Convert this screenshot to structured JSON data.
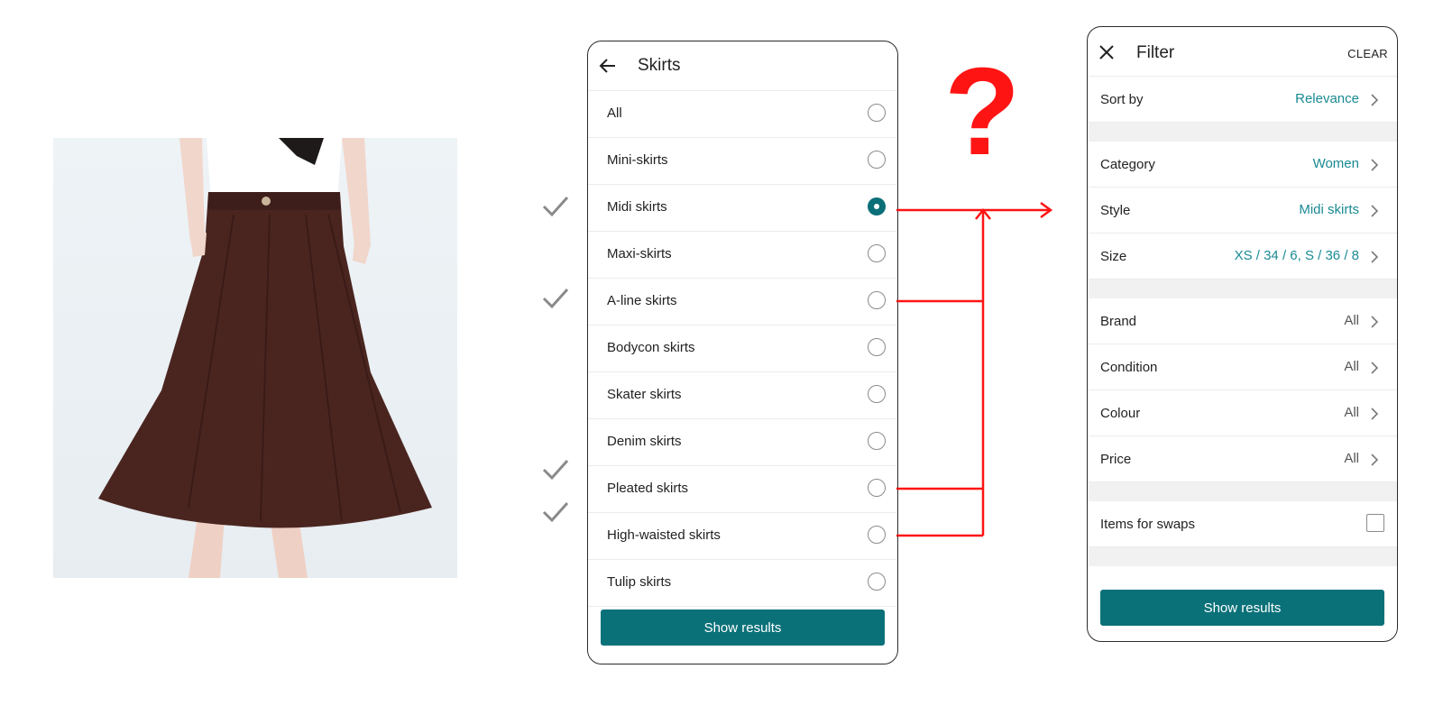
{
  "left_panel": {
    "title": "Skirts",
    "items": [
      {
        "label": "All",
        "selected": false
      },
      {
        "label": "Mini-skirts",
        "selected": false
      },
      {
        "label": "Midi skirts",
        "selected": true
      },
      {
        "label": "Maxi-skirts",
        "selected": false
      },
      {
        "label": "A-line skirts",
        "selected": false
      },
      {
        "label": "Bodycon skirts",
        "selected": false
      },
      {
        "label": "Skater skirts",
        "selected": false
      },
      {
        "label": "Denim skirts",
        "selected": false
      },
      {
        "label": "Pleated skirts",
        "selected": false
      },
      {
        "label": "High-waisted skirts",
        "selected": false
      },
      {
        "label": "Tulip skirts",
        "selected": false
      }
    ],
    "show_results_label": "Show results"
  },
  "right_panel": {
    "title": "Filter",
    "clear_label": "CLEAR",
    "sort_by": {
      "label": "Sort by",
      "value": "Relevance"
    },
    "category": {
      "label": "Category",
      "value": "Women"
    },
    "style": {
      "label": "Style",
      "value": "Midi skirts"
    },
    "size": {
      "label": "Size",
      "value": "XS / 34 / 6, S / 36 / 8"
    },
    "brand": {
      "label": "Brand",
      "value": "All"
    },
    "condition": {
      "label": "Condition",
      "value": "All"
    },
    "colour": {
      "label": "Colour",
      "value": "All"
    },
    "price": {
      "label": "Price",
      "value": "All"
    },
    "swaps": {
      "label": "Items for swaps",
      "checked": false
    },
    "show_results_label": "Show results"
  },
  "annotations": {
    "question_mark": "?",
    "checked_items": [
      "Midi skirts",
      "A-line skirts",
      "Pleated skirts",
      "High-waisted skirts"
    ]
  },
  "colors": {
    "accent": "#0b7179",
    "accent_text": "#1a8a93",
    "annotation_red": "#ff1414",
    "skirt_brown": "#4a2520"
  },
  "icons": {
    "back": "arrow-left-icon",
    "close": "close-icon",
    "chevron": "chevron-right-icon",
    "tick": "checkmark-icon"
  }
}
